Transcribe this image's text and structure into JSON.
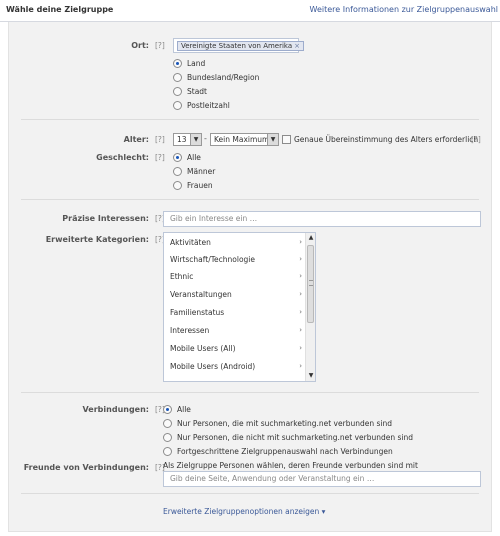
{
  "header": {
    "title": "Wähle deine Zielgruppe",
    "info_link": "Weitere Informationen zur Zielgruppenauswahl"
  },
  "help_mark": "[?]",
  "location": {
    "label": "Ort:",
    "token": "Vereinigte Staaten von Amerika",
    "token_remove": "×",
    "options": [
      "Land",
      "Bundesland/Region",
      "Stadt",
      "Postleitzahl"
    ],
    "selected_index": 0
  },
  "age": {
    "label": "Alter:",
    "min_value": "13",
    "separator": "-",
    "max_value": "Kein Maximum",
    "exact_match_label": "Genaue Übereinstimmung des Alters erforderlich",
    "exact_match_checked": false
  },
  "gender": {
    "label": "Geschlecht:",
    "options": [
      "Alle",
      "Männer",
      "Frauen"
    ],
    "selected_index": 0
  },
  "precise_interests": {
    "label": "Präzise Interessen:",
    "placeholder": "Gib ein Interesse ein …"
  },
  "extended_categories": {
    "label": "Erweiterte Kategorien:",
    "items": [
      "Aktivitäten",
      "Wirtschaft/Technologie",
      "Ethnic",
      "Veranstaltungen",
      "Familienstatus",
      "Interessen",
      "Mobile Users (All)",
      "Mobile Users (Android)"
    ],
    "chevron": "›"
  },
  "connections": {
    "label": "Verbindungen:",
    "options": [
      "Alle",
      "Nur Personen, die mit suchmarketing.net verbunden sind",
      "Nur Personen, die nicht mit suchmarketing.net verbunden sind",
      "Fortgeschrittene Zielgruppenauswahl nach Verbindungen"
    ],
    "selected_index": 0
  },
  "friends_of_connections": {
    "label": "Freunde von Verbindungen:",
    "description": "Als Zielgruppe Personen wählen, deren Freunde verbunden sind mit",
    "placeholder": "Gib deine Seite, Anwendung oder Veranstaltung ein …"
  },
  "footer": {
    "advanced_link": "Erweiterte Zielgruppenoptionen anzeigen ▾"
  }
}
